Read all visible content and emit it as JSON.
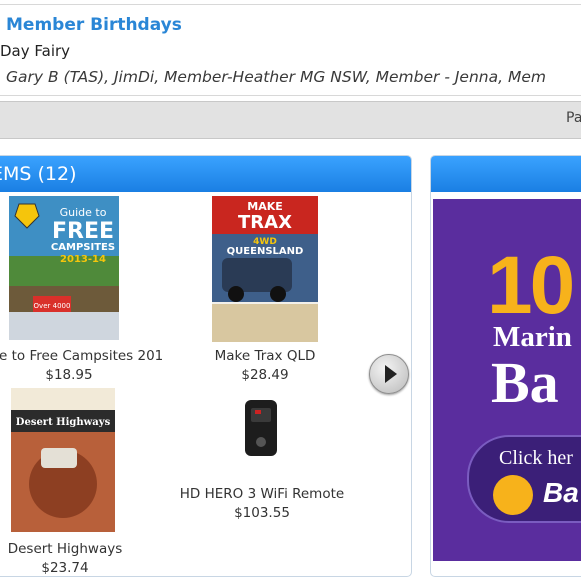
{
  "birthdays": {
    "title": "Member Birthdays",
    "subtitle": "Day Fairy",
    "names": "Gary B (TAS), JimDi, Member-Heather MG NSW, Member - Jenna, Mem"
  },
  "pagination_bar": {
    "text": "Pa"
  },
  "items": {
    "title": "EMS (12)",
    "products": [
      {
        "name": "e to Free Campsites 201",
        "price": "$18.95",
        "cover_text": [
          "Guide to",
          "FREE",
          "CAMPSITES",
          "2013-14",
          "Over 4000"
        ]
      },
      {
        "name": "Make Trax QLD",
        "price": "$28.49",
        "cover_text": [
          "MAKE",
          "TRAX",
          "4WD",
          "QUEENSLAND"
        ]
      },
      {
        "name": "Desert Highways",
        "price": "$23.74",
        "cover_text": [
          "Desert Highways"
        ]
      },
      {
        "name": "HD HERO 3 WiFi Remote",
        "price": "$103.55",
        "cover_text": []
      }
    ],
    "next_button_icon": "play-arrow-icon"
  },
  "ad": {
    "big_text": "10",
    "line1": "Marin",
    "line2": "Ba",
    "cta": "Click her",
    "logo_text": "Ba",
    "colors": {
      "background": "#5a2d9e",
      "accent": "#f7b21b"
    }
  }
}
